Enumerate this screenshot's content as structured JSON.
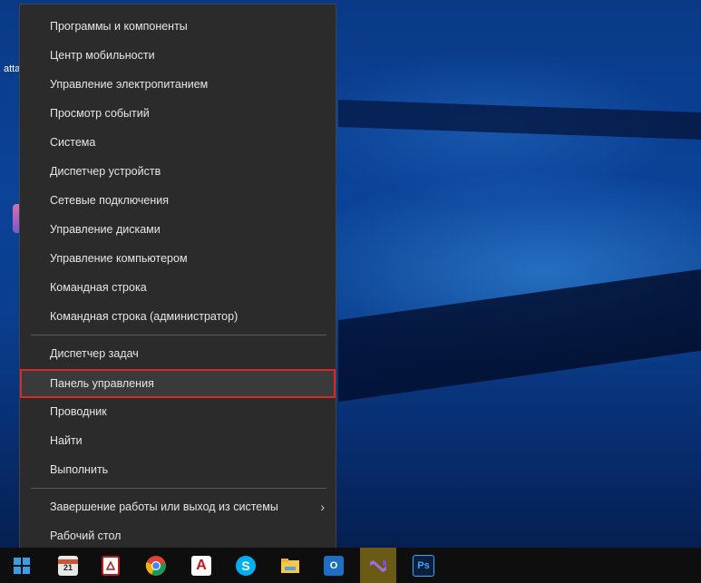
{
  "desktop": {
    "label_text": "atta"
  },
  "menu": {
    "group1": [
      "Программы и компоненты",
      "Центр мобильности",
      "Управление электропитанием",
      "Просмотр событий",
      "Система",
      "Диспетчер устройств",
      "Сетевые подключения",
      "Управление дисками",
      "Управление компьютером",
      "Командная строка",
      "Командная строка (администратор)"
    ],
    "group2": [
      "Диспетчер задач",
      "Панель управления",
      "Проводник",
      "Найти",
      "Выполнить"
    ],
    "group3": [
      "Завершение работы или выход из системы",
      "Рабочий стол"
    ],
    "selected_item": "Панель управления",
    "submenu_arrow": "›"
  },
  "taskbar": {
    "icons": [
      "windows-start-icon",
      "calendar-app-icon",
      "pdf-reader-icon",
      "chrome-icon",
      "autocad-icon",
      "skype-icon",
      "file-explorer-icon",
      "outlook-icon",
      "visual-studio-icon",
      "photoshop-icon"
    ],
    "calendar_text": "21",
    "photoshop_text": "Ps",
    "autocad_text": "A",
    "skype_text": "S"
  },
  "colors": {
    "highlight_border": "#d62a2a",
    "menu_bg": "#2b2b2b",
    "taskbar_bg": "#0e0e0e"
  }
}
